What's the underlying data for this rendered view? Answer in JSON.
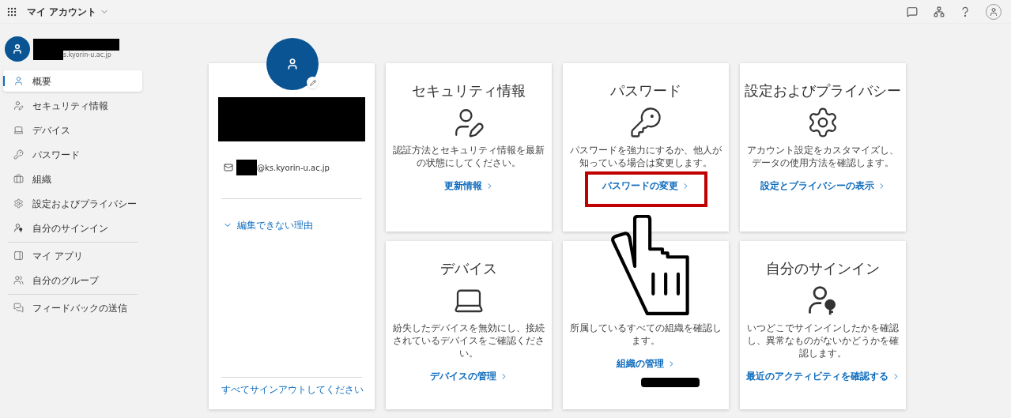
{
  "top_bar": {
    "title": "マイ アカウント"
  },
  "sidebar": {
    "account_domain": "s.kyorin-u.ac.jp",
    "groups": [
      [
        {
          "label": "概要",
          "selected": true
        },
        {
          "label": "セキュリティ情報",
          "selected": false
        },
        {
          "label": "デバイス",
          "selected": false
        },
        {
          "label": "パスワード",
          "selected": false
        },
        {
          "label": "組織",
          "selected": false
        },
        {
          "label": "設定およびプライバシー",
          "selected": false
        },
        {
          "label": "自分のサインイン",
          "selected": false
        }
      ],
      [
        {
          "label": "マイ アプリ",
          "selected": false
        },
        {
          "label": "自分のグループ",
          "selected": false
        }
      ],
      [
        {
          "label": "フィードバックの送信",
          "selected": false
        }
      ]
    ]
  },
  "profile": {
    "email_domain": "@ks.kyorin-u.ac.jp",
    "expander": {
      "label": "編集できない理由",
      "expanded": false
    },
    "sign_out_link": "すべてサインアウトしてください"
  },
  "cards": [
    {
      "title": "セキュリティ情報",
      "description": "認証方法とセキュリティ情報を最新の状態にしてください。",
      "link": "更新情報",
      "highlighted": false
    },
    {
      "title": "パスワード",
      "description": "パスワードを強力にするか、他人が知っている場合は変更します。",
      "link": "パスワードの変更",
      "highlighted": true
    },
    {
      "title": "設定およびプライバシー",
      "description": "アカウント設定をカスタマイズし、データの使用方法を確認します。",
      "link": "設定とプライバシーの表示",
      "highlighted": false
    },
    {
      "title": "デバイス",
      "description": "紛失したデバイスを無効にし、接続されているデバイスをご確認ください。",
      "link": "デバイスの管理",
      "highlighted": false
    },
    {
      "description": "所属しているすべての組織を確認します。",
      "link": "組織の管理",
      "highlighted": false
    },
    {
      "title": "自分のサインイン",
      "description": "いつどこでサインインしたかを確認し、異常なものがないかどうかを確認します。",
      "link": "最近のアクティビティを確認する",
      "highlighted": false
    }
  ]
}
